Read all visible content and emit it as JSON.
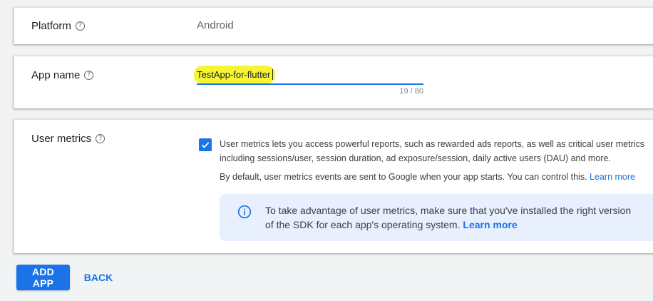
{
  "platform": {
    "label": "Platform",
    "value": "Android",
    "help_icon": "help-circle-icon"
  },
  "app_name": {
    "label": "App name",
    "value": "TestApp-for-flutter",
    "char_count": "19 / 80",
    "help_icon": "help-circle-icon"
  },
  "user_metrics": {
    "label": "User metrics",
    "checked": true,
    "desc_line_1": "User metrics lets you access powerful reports, such as rewarded ads reports, as well as critical user metrics",
    "desc_line_2": "including sessions/user, session duration, ad exposure/session, daily active users (DAU) and more.",
    "desc_line_3": "By default, user metrics events are sent to Google when your app starts. You can control this.",
    "learn_more_1": "Learn more",
    "info_line_1": "To take advantage of user metrics, make sure that you've installed the right version",
    "info_line_2": "of the SDK for each app's operating system.",
    "learn_more_2": "Learn more",
    "help_icon": "help-circle-icon",
    "info_icon": "info-icon"
  },
  "actions": {
    "add_app": "ADD APP",
    "back": "BACK"
  },
  "colors": {
    "accent": "#1a73e8",
    "highlight": "#f5f534",
    "info_bg": "#e8f0fe"
  }
}
